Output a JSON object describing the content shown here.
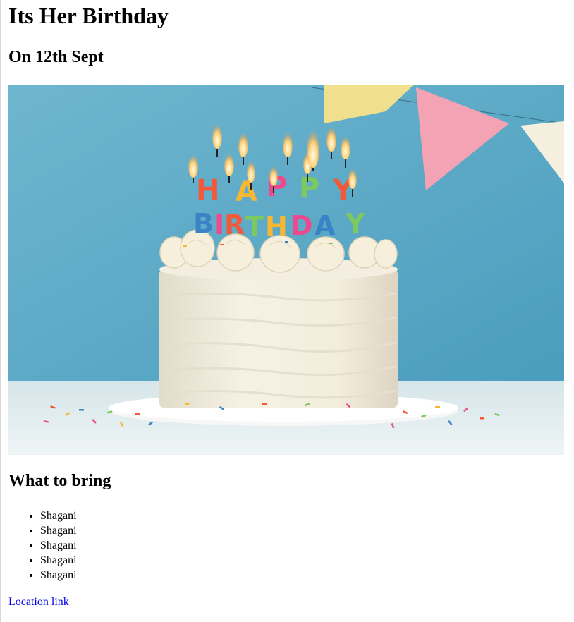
{
  "page": {
    "title": "Its Her Birthday",
    "date": "On 12th Sept"
  },
  "image": {
    "subject": "birthday-cake-photo",
    "colors": {
      "wall": "#5ba8c6",
      "table": "#e3ecee",
      "frosting": "#f1ead8"
    }
  },
  "bring": {
    "heading": "What to bring",
    "items": [
      "Shagani",
      "Shagani",
      "Shagani",
      "Shagani",
      "Shagani"
    ]
  },
  "link": {
    "label": "Location link"
  }
}
